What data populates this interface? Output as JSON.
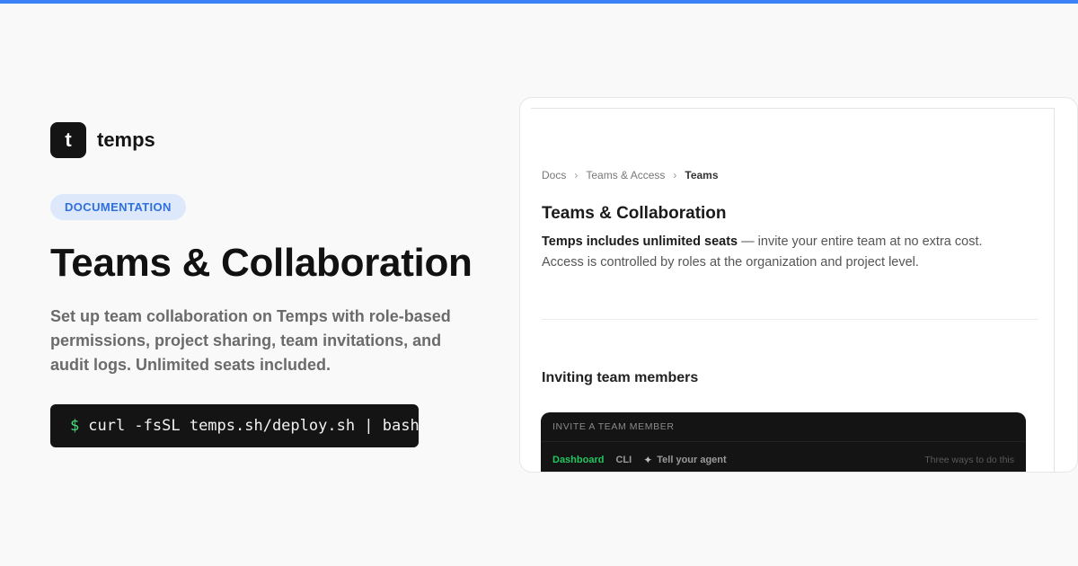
{
  "brand": {
    "logo_letter": "t",
    "name": "temps"
  },
  "badge": "DOCUMENTATION",
  "hero": {
    "title": "Teams & Collaboration",
    "description": "Set up team collaboration on Temps with role-based permissions, project sharing, team invitations, and audit logs. Unlimited seats included."
  },
  "command": {
    "prompt": "$",
    "text": "curl -fsSL temps.sh/deploy.sh | bash"
  },
  "preview": {
    "breadcrumb": {
      "items": [
        "Docs",
        "Teams & Access"
      ],
      "current": "Teams",
      "separator": "›"
    },
    "title": "Teams & Collaboration",
    "intro_bold": "Temps includes unlimited seats",
    "intro_rest": " — invite your entire team at no extra cost.",
    "intro_line2": "Access is controlled by roles at the organization and project level.",
    "section_heading": "Inviting team members",
    "invite_panel": {
      "header": "INVITE A TEAM MEMBER",
      "tabs": [
        "Dashboard",
        "CLI",
        "Tell your agent"
      ],
      "hint": "Three ways to do this"
    }
  },
  "colors": {
    "accent": "#3b82f6",
    "badge_bg": "#dde9fb",
    "badge_text": "#2f6fe0",
    "prompt_green": "#4ade80",
    "active_tab_green": "#22c55e"
  },
  "icons": [
    "sparkle-icon",
    "chevron-right-icon"
  ]
}
